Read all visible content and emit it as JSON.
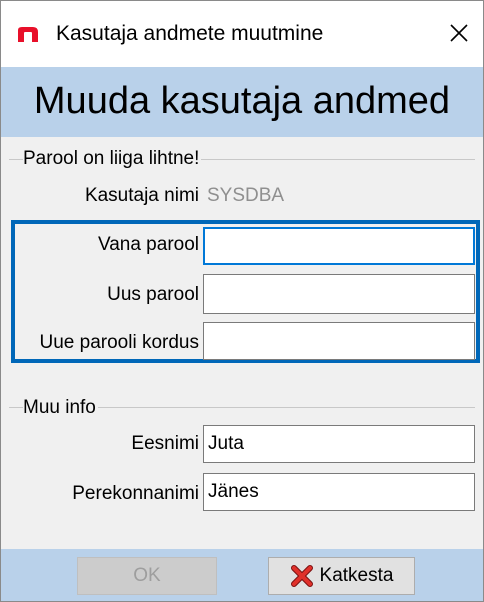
{
  "window": {
    "title": "Kasutaja andmete muutmine",
    "app_icon": "n-logo-icon",
    "close_icon": "close-icon"
  },
  "banner": {
    "heading": "Muuda kasutaja andmed"
  },
  "password_section": {
    "label": "Parool on liiga lihtne!",
    "username_label": "Kasutaja nimi",
    "username_value": "SYSDBA",
    "old_password_label": "Vana parool",
    "old_password_value": "",
    "new_password_label": "Uus parool",
    "new_password_value": "",
    "repeat_password_label": "Uue parooli kordus",
    "repeat_password_value": ""
  },
  "other_section": {
    "label": "Muu info",
    "first_name_label": "Eesnimi",
    "first_name_value": "Juta",
    "last_name_label": "Perekonnanimi",
    "last_name_value": "Jänes"
  },
  "buttons": {
    "ok_label": "OK",
    "ok_enabled": false,
    "cancel_label": "Katkesta",
    "cancel_icon": "red-x-icon"
  },
  "colors": {
    "banner": "#b9d1ea",
    "focus_frame": "#0067b8",
    "logo": "#e8102a"
  }
}
